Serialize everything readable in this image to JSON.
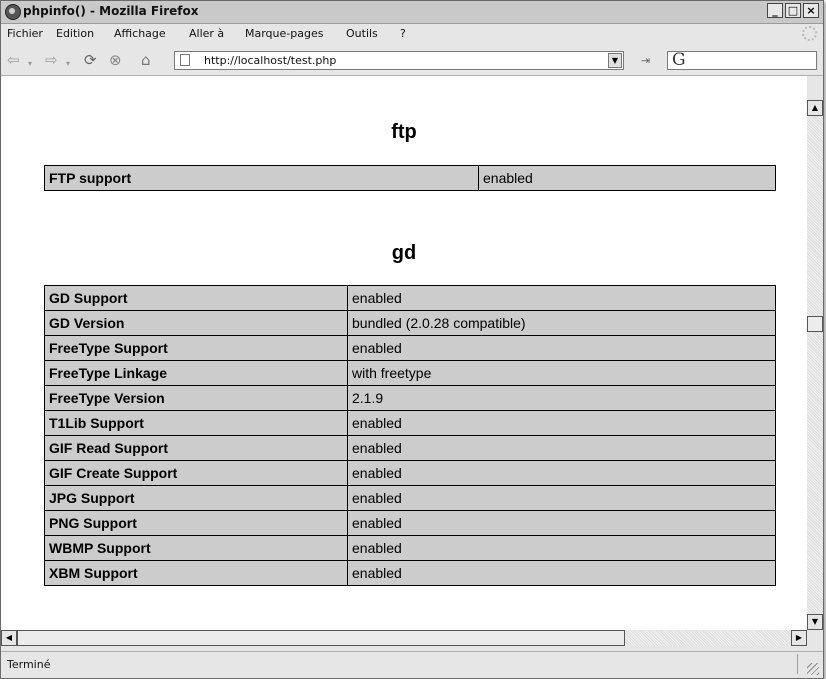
{
  "window": {
    "title": "phpinfo() - Mozilla Firefox",
    "min_label": "_",
    "max_label": "□",
    "close_label": "×"
  },
  "menu": {
    "items": [
      {
        "label": "Fichier"
      },
      {
        "label": "Edition"
      },
      {
        "label": "Affichage"
      },
      {
        "label": "Aller à"
      },
      {
        "label": "Marque-pages"
      },
      {
        "label": "Outils"
      },
      {
        "label": "?"
      }
    ]
  },
  "nav": {
    "url": "http://localhost/test.php",
    "search_logo": "G"
  },
  "page": {
    "sections": [
      {
        "heading": "ftp",
        "rows": [
          {
            "key": "FTP support",
            "value": "enabled"
          }
        ]
      },
      {
        "heading": "gd",
        "rows": [
          {
            "key": "GD Support",
            "value": "enabled"
          },
          {
            "key": "GD Version",
            "value": "bundled (2.0.28 compatible)"
          },
          {
            "key": "FreeType Support",
            "value": "enabled"
          },
          {
            "key": "FreeType Linkage",
            "value": "with freetype"
          },
          {
            "key": "FreeType Version",
            "value": "2.1.9"
          },
          {
            "key": "T1Lib Support",
            "value": "enabled"
          },
          {
            "key": "GIF Read Support",
            "value": "enabled"
          },
          {
            "key": "GIF Create Support",
            "value": "enabled"
          },
          {
            "key": "JPG Support",
            "value": "enabled"
          },
          {
            "key": "PNG Support",
            "value": "enabled"
          },
          {
            "key": "WBMP Support",
            "value": "enabled"
          },
          {
            "key": "XBM Support",
            "value": "enabled"
          }
        ]
      }
    ]
  },
  "status": {
    "text": "Terminé"
  },
  "colors": {
    "table_cell": "#cccccc",
    "chrome": "#e6e6e6",
    "titlebar": "#c9c9c9"
  }
}
